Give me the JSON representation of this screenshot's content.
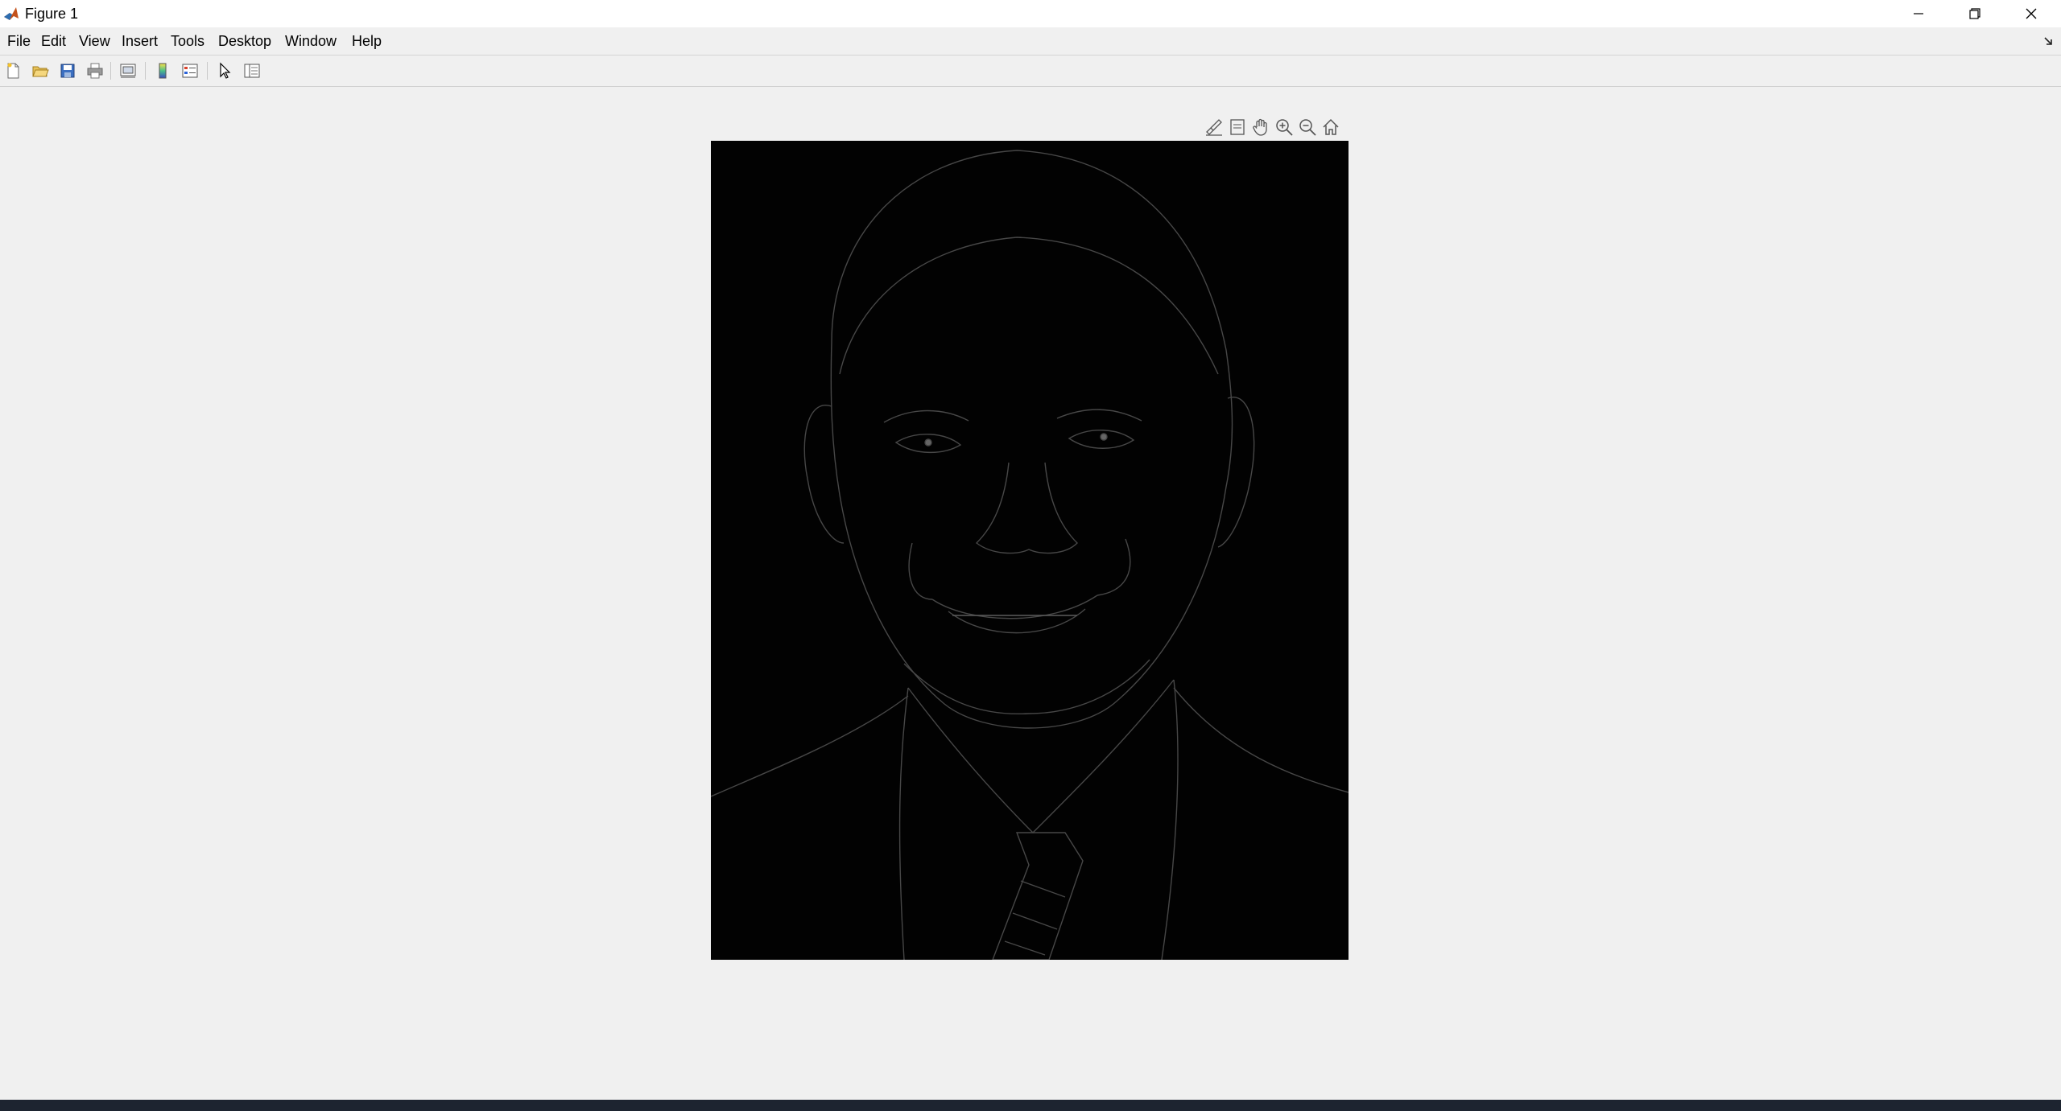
{
  "window": {
    "title": "Figure 1",
    "icons": {
      "app": "matlab-logo-icon",
      "minimize": "minimize-icon",
      "maximize": "restore-icon",
      "close": "close-icon"
    }
  },
  "menubar": {
    "items": [
      {
        "id": "file",
        "label": "File"
      },
      {
        "id": "edit",
        "label": "Edit"
      },
      {
        "id": "view",
        "label": "View"
      },
      {
        "id": "insert",
        "label": "Insert"
      },
      {
        "id": "tools",
        "label": "Tools"
      },
      {
        "id": "desktop",
        "label": "Desktop"
      },
      {
        "id": "window",
        "label": "Window"
      },
      {
        "id": "help",
        "label": "Help"
      }
    ],
    "corner_icon": "dock-arrow-icon"
  },
  "toolbar": {
    "buttons": [
      "new-figure-icon",
      "open-file-icon",
      "save-icon",
      "print-icon",
      "link-plot-icon",
      "colorbar-icon",
      "legend-icon",
      "edit-plot-arrow-icon",
      "property-inspector-icon"
    ]
  },
  "axes_toolbar": {
    "buttons": [
      "brush-icon",
      "data-tips-icon",
      "pan-hand-icon",
      "zoom-in-icon",
      "zoom-out-icon",
      "home-restore-view-icon"
    ]
  },
  "figure": {
    "content": "edge-detected grayscale portrait on black background",
    "background_color": "#020202",
    "edge_color": "#6a6a6a"
  }
}
